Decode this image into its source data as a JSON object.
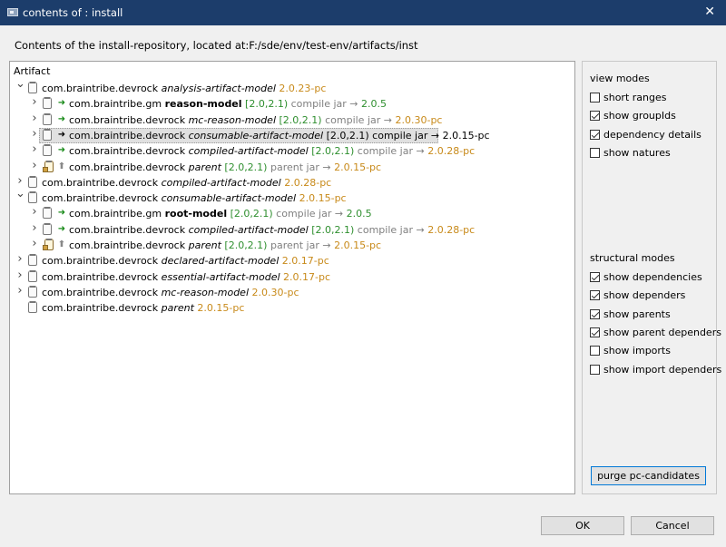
{
  "window": {
    "title": "contents of : install",
    "close_glyph": "✕"
  },
  "header": {
    "text": "Contents of the install-repository, located at:F:/sde/env/test-env/artifacts/inst"
  },
  "tree": {
    "column_header": "Artifact",
    "rows": [
      {
        "depth": 0,
        "expander": "open",
        "rel": "",
        "selected": false,
        "group": "com.braintribe.devrock",
        "artifact": "analysis-artifact-model",
        "artifact_style": "italic",
        "range": "",
        "version": "2.0.23-pc",
        "version_color": "orange",
        "scope": "",
        "packaging": "",
        "resolved": "",
        "resolved_color": "orange"
      },
      {
        "depth": 1,
        "expander": "closed",
        "rel": "green-arrow",
        "selected": false,
        "group": "com.braintribe.gm",
        "artifact": "reason-model",
        "artifact_style": "bold",
        "range": "[2.0,2.1)",
        "version": "",
        "version_color": "",
        "scope": "compile",
        "packaging": "jar",
        "resolved": "2.0.5",
        "resolved_color": "green"
      },
      {
        "depth": 1,
        "expander": "closed",
        "rel": "green-arrow",
        "selected": false,
        "group": "com.braintribe.devrock",
        "artifact": "mc-reason-model",
        "artifact_style": "italic",
        "range": "[2.0,2.1)",
        "version": "",
        "version_color": "",
        "scope": "compile",
        "packaging": "jar",
        "resolved": "2.0.30-pc",
        "resolved_color": "orange"
      },
      {
        "depth": 1,
        "expander": "closed",
        "rel": "black-arrow",
        "selected": true,
        "group": "com.braintribe.devrock",
        "artifact": "consumable-artifact-model",
        "artifact_style": "italic",
        "range": "[2.0,2.1)",
        "version": "",
        "version_color": "",
        "scope": "compile",
        "packaging": "jar",
        "resolved": "2.0.15-pc",
        "resolved_color": "black"
      },
      {
        "depth": 1,
        "expander": "closed",
        "rel": "green-arrow",
        "selected": false,
        "group": "com.braintribe.devrock",
        "artifact": "compiled-artifact-model",
        "artifact_style": "italic",
        "range": "[2.0,2.1)",
        "version": "",
        "version_color": "",
        "scope": "compile",
        "packaging": "jar",
        "resolved": "2.0.28-pc",
        "resolved_color": "orange"
      },
      {
        "depth": 1,
        "expander": "closed",
        "rel": "gray-up-arrow",
        "selected": false,
        "parent": true,
        "group": "com.braintribe.devrock",
        "artifact": "parent",
        "artifact_style": "italic",
        "range": "[2.0,2.1)",
        "version": "",
        "version_color": "",
        "scope": "parent",
        "packaging": "jar",
        "resolved": "2.0.15-pc",
        "resolved_color": "orange"
      },
      {
        "depth": 0,
        "expander": "closed",
        "rel": "",
        "selected": false,
        "group": "com.braintribe.devrock",
        "artifact": "compiled-artifact-model",
        "artifact_style": "italic",
        "range": "",
        "version": "2.0.28-pc",
        "version_color": "orange",
        "scope": "",
        "packaging": "",
        "resolved": "",
        "resolved_color": "orange"
      },
      {
        "depth": 0,
        "expander": "open",
        "rel": "",
        "selected": false,
        "group": "com.braintribe.devrock",
        "artifact": "consumable-artifact-model",
        "artifact_style": "italic",
        "range": "",
        "version": "2.0.15-pc",
        "version_color": "orange",
        "scope": "",
        "packaging": "",
        "resolved": "",
        "resolved_color": "orange"
      },
      {
        "depth": 1,
        "expander": "closed",
        "rel": "green-arrow",
        "selected": false,
        "group": "com.braintribe.gm",
        "artifact": "root-model",
        "artifact_style": "bold",
        "range": "[2.0,2.1)",
        "version": "",
        "version_color": "",
        "scope": "compile",
        "packaging": "jar",
        "resolved": "2.0.5",
        "resolved_color": "green"
      },
      {
        "depth": 1,
        "expander": "closed",
        "rel": "green-arrow",
        "selected": false,
        "group": "com.braintribe.devrock",
        "artifact": "compiled-artifact-model",
        "artifact_style": "italic",
        "range": "[2.0,2.1)",
        "version": "",
        "version_color": "",
        "scope": "compile",
        "packaging": "jar",
        "resolved": "2.0.28-pc",
        "resolved_color": "orange"
      },
      {
        "depth": 1,
        "expander": "closed",
        "rel": "gray-up-arrow",
        "selected": false,
        "parent": true,
        "group": "com.braintribe.devrock",
        "artifact": "parent",
        "artifact_style": "italic",
        "range": "[2.0,2.1)",
        "version": "",
        "version_color": "",
        "scope": "parent",
        "packaging": "jar",
        "resolved": "2.0.15-pc",
        "resolved_color": "orange"
      },
      {
        "depth": 0,
        "expander": "closed",
        "rel": "",
        "selected": false,
        "group": "com.braintribe.devrock",
        "artifact": "declared-artifact-model",
        "artifact_style": "italic",
        "range": "",
        "version": "2.0.17-pc",
        "version_color": "orange",
        "scope": "",
        "packaging": "",
        "resolved": "",
        "resolved_color": "orange"
      },
      {
        "depth": 0,
        "expander": "closed",
        "rel": "",
        "selected": false,
        "group": "com.braintribe.devrock",
        "artifact": "essential-artifact-model",
        "artifact_style": "italic",
        "range": "",
        "version": "2.0.17-pc",
        "version_color": "orange",
        "scope": "",
        "packaging": "",
        "resolved": "",
        "resolved_color": "orange"
      },
      {
        "depth": 0,
        "expander": "closed",
        "rel": "",
        "selected": false,
        "group": "com.braintribe.devrock",
        "artifact": "mc-reason-model",
        "artifact_style": "italic",
        "range": "",
        "version": "2.0.30-pc",
        "version_color": "orange",
        "scope": "",
        "packaging": "",
        "resolved": "",
        "resolved_color": "orange"
      },
      {
        "depth": 0,
        "expander": "none",
        "rel": "",
        "selected": false,
        "group": "com.braintribe.devrock",
        "artifact": "parent",
        "artifact_style": "italic",
        "range": "",
        "version": "2.0.15-pc",
        "version_color": "orange",
        "scope": "",
        "packaging": "",
        "resolved": "",
        "resolved_color": "orange"
      }
    ]
  },
  "view_modes": {
    "title": "view modes",
    "options": [
      {
        "label": "short ranges",
        "checked": false
      },
      {
        "label": "show groupIds",
        "checked": true
      },
      {
        "label": "dependency details",
        "checked": true
      },
      {
        "label": "show natures",
        "checked": false
      }
    ]
  },
  "structural_modes": {
    "title": "structural modes",
    "options": [
      {
        "label": "show dependencies",
        "checked": true
      },
      {
        "label": "show dependers",
        "checked": true
      },
      {
        "label": "show parents",
        "checked": true
      },
      {
        "label": "show parent dependers",
        "checked": true
      },
      {
        "label": "show imports",
        "checked": false
      },
      {
        "label": "show import dependers",
        "checked": false
      }
    ]
  },
  "purge_button": "purge pc-candidates",
  "buttons": {
    "ok": "OK",
    "cancel": "Cancel"
  },
  "arrow_glyph": "→"
}
